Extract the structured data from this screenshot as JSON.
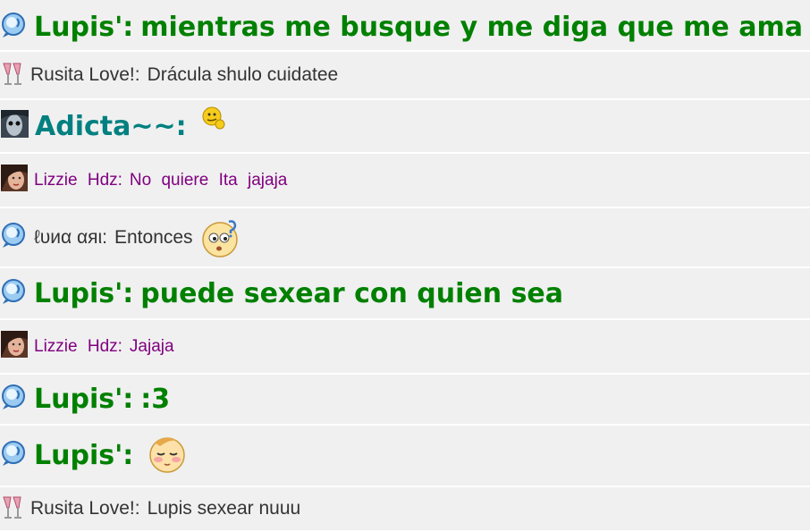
{
  "colors": {
    "green": "#008000",
    "teal": "#008080",
    "purple": "#800080",
    "gray": "#333333",
    "row_bg": "#f0f0f0"
  },
  "messages": [
    {
      "avatar": "bubble-icon",
      "name": "Lupis':",
      "text": "mientras me busque y me diga que me ama a mi",
      "style": "big",
      "color": "#008000"
    },
    {
      "avatar": "champagne-glasses-icon",
      "name": "Rusita Love!:",
      "text": "Drácula shulo cuidatee",
      "style": "normal",
      "color": "#333333"
    },
    {
      "avatar": "dark-face-avatar",
      "name": "Adicta~~:",
      "text": "",
      "emoticon": "thinking-emoticon",
      "style": "big",
      "color": "#008080"
    },
    {
      "avatar": "woman-photo-avatar",
      "name": "Lizzie Hdz:",
      "text": "No quiere Ita jajaja",
      "style": "spaced",
      "color": "#800080"
    },
    {
      "avatar": "bubble-icon",
      "name": "ℓυиα αяι:",
      "text": "Entonces",
      "emoticon": "confused-emoticon",
      "style": "normal",
      "color": "#333333"
    },
    {
      "avatar": "bubble-icon",
      "name": "Lupis':",
      "text": "puede sexear con quien sea",
      "style": "big",
      "color": "#008000"
    },
    {
      "avatar": "woman-photo-avatar",
      "name": "Lizzie Hdz:",
      "text": "Jajaja",
      "style": "spaced",
      "color": "#800080"
    },
    {
      "avatar": "bubble-icon",
      "name": "Lupis':",
      "text": ":3",
      "style": "big",
      "color": "#008000"
    },
    {
      "avatar": "bubble-icon",
      "name": "Lupis':",
      "text": "",
      "emoticon": "blushing-emoticon",
      "style": "big",
      "color": "#008000"
    },
    {
      "avatar": "champagne-glasses-icon",
      "name": "Rusita Love!:",
      "text": "Lupis sexear nuuu",
      "style": "normal",
      "color": "#333333"
    }
  ]
}
